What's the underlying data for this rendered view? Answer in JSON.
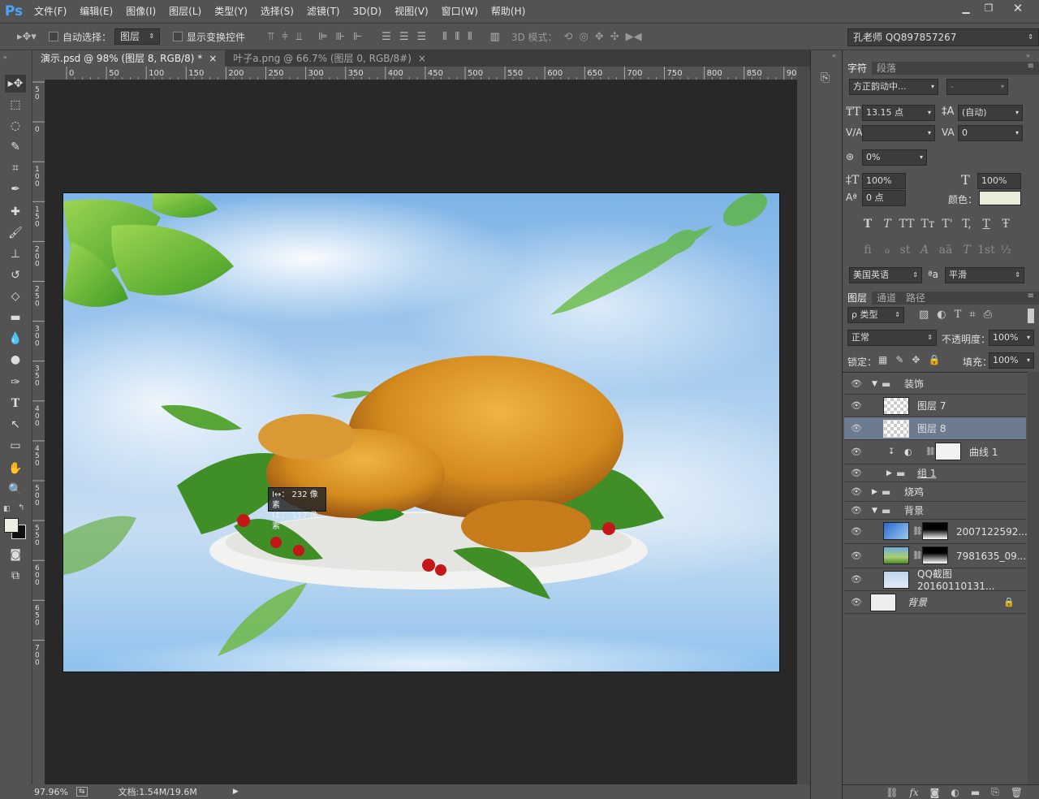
{
  "app": {
    "logo": "Ps"
  },
  "menu": [
    "文件(F)",
    "编辑(E)",
    "图像(I)",
    "图层(L)",
    "类型(Y)",
    "选择(S)",
    "滤镜(T)",
    "3D(D)",
    "视图(V)",
    "窗口(W)",
    "帮助(H)"
  ],
  "window_controls": [
    "minimize-icon",
    "restore-icon",
    "close-icon"
  ],
  "options": {
    "auto_select_label": "自动选择：",
    "auto_select_target": "图层",
    "show_transform_label": "显示变换控件",
    "mode_3d_label": "3D 模式：",
    "workspace": "孔老师 QQ897857267"
  },
  "tabs": [
    {
      "label": "演示.psd @ 98% (图层 8, RGB/8) *",
      "close": "×"
    },
    {
      "label": "叶子a.png @ 66.7% (图层 0, RGB/8#)",
      "close": "×"
    }
  ],
  "ruler": {
    "top_ticks": [
      "0",
      "50",
      "100",
      "150",
      "200",
      "250",
      "300",
      "350",
      "400",
      "450",
      "500",
      "550",
      "600",
      "650",
      "700",
      "750",
      "800",
      "850",
      "900"
    ],
    "left_ticks": [
      "50",
      "0",
      "100",
      "150",
      "200",
      "250",
      "300",
      "350",
      "400",
      "450",
      "500",
      "550",
      "600",
      "650",
      "700"
    ]
  },
  "measure": {
    "width": "232 像素",
    "height": "117 像素",
    "w_icon": "I↔：",
    "h_icon": "I↕："
  },
  "status": {
    "zoom": "97.96%",
    "doc": "文档:1.54M/19.6M"
  },
  "character_panel": {
    "tabs": [
      "字符",
      "段落"
    ],
    "font_family": "方正韵动中...",
    "font_style": "-",
    "font_size": "13.15 点",
    "leading": "(自动)",
    "kerning": "",
    "tracking": "0",
    "tsume": "0%",
    "vscale": "100%",
    "hscale": "100%",
    "baseline": "0 点",
    "color_label": "颜色：",
    "color": "#e8ecd8",
    "language": "美国英语",
    "aa_label": "ªa",
    "antialias": "平滑",
    "type_buttons": [
      "T",
      "T",
      "TT",
      "Tт",
      "T'",
      "T,",
      "T",
      "Ŧ"
    ],
    "opentype_buttons": [
      "fi",
      "ℴ",
      "st",
      "A",
      "aā",
      "T",
      "1st",
      "½"
    ]
  },
  "layers_panel": {
    "tabs": [
      "图层",
      "通道",
      "路径"
    ],
    "filter": "ρ 类型",
    "blend_mode": "正常",
    "opacity_label": "不透明度：",
    "opacity": "100%",
    "lock_label": "锁定：",
    "fill_label": "填充：",
    "fill": "100%",
    "layers": [
      {
        "name": "装饰",
        "type": "group",
        "open": true
      },
      {
        "name": "图层 7",
        "type": "layer"
      },
      {
        "name": "图层 8",
        "type": "layer",
        "selected": true
      },
      {
        "name": "曲线 1",
        "type": "adjustment"
      },
      {
        "name": "组 1",
        "type": "group",
        "open": false
      },
      {
        "name": "烧鸡",
        "type": "group",
        "open": false
      },
      {
        "name": "背景",
        "type": "group",
        "open": true
      },
      {
        "name": "2007122592...",
        "type": "layer"
      },
      {
        "name": "7981635_09...",
        "type": "layer"
      },
      {
        "name": "QQ截图20160110131...",
        "type": "layer"
      },
      {
        "name": "背景",
        "type": "background",
        "locked": true
      }
    ],
    "footer_icons": [
      "link-icon",
      "fx-icon",
      "mask-icon",
      "adjustment-icon",
      "folder-icon",
      "new-layer-icon",
      "trash-icon"
    ]
  }
}
